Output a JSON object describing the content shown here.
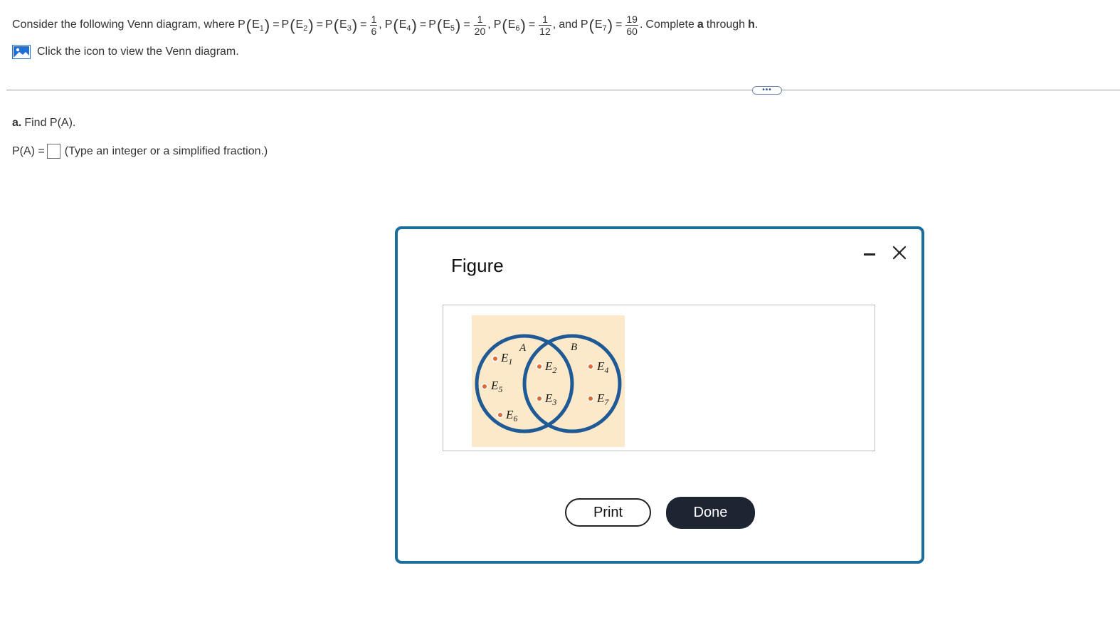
{
  "problem": {
    "intro": "Consider the following Venn diagram, where",
    "P": "P",
    "E": "E",
    "eq": "=",
    "comma": ",",
    "period": ".",
    "subs": [
      "1",
      "2",
      "3",
      "4",
      "5",
      "6",
      "7"
    ],
    "frac1": {
      "num": "1",
      "den": "6"
    },
    "frac2": {
      "num": "1",
      "den": "20"
    },
    "frac3": {
      "num": "1",
      "den": "12"
    },
    "frac4": {
      "num": "19",
      "den": "60"
    },
    "and": "and",
    "complete_prefix": "Complete",
    "complete_a": "a",
    "complete_through": "through",
    "complete_h": "h"
  },
  "venn_link": {
    "label": "Click the icon to view the Venn diagram.",
    "icon": "image-icon"
  },
  "more_button": {
    "label": "•••"
  },
  "part_a": {
    "letter": "a.",
    "text": "Find P(A).",
    "answer_label": "P(A) =",
    "answer_value": "",
    "hint": "(Type an integer or a simplified fraction.)"
  },
  "modal": {
    "title": "Figure",
    "minimize_icon": "minimize-icon",
    "close_icon": "close-icon",
    "venn": {
      "set_a": "A",
      "set_b": "B",
      "E": "E",
      "subs": [
        "1",
        "2",
        "3",
        "4",
        "5",
        "6",
        "7"
      ],
      "colors": {
        "background": "#fbe9c9",
        "circle": "#1f5a96",
        "point": "#e06a32"
      }
    },
    "print_label": "Print",
    "done_label": "Done"
  }
}
